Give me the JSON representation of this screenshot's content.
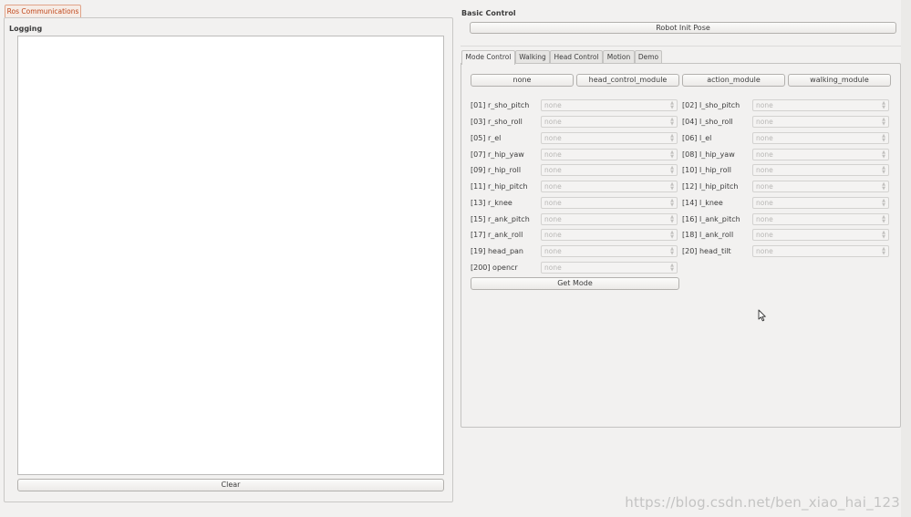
{
  "left_panel": {
    "tab_label": "Ros Communications",
    "logging_title": "Logging",
    "clear_label": "Clear"
  },
  "basic_control": {
    "title": "Basic Control",
    "robot_init_pose_label": "Robot Init Pose"
  },
  "tabs": [
    {
      "label": "Mode Control",
      "active": true
    },
    {
      "label": "Walking",
      "active": false
    },
    {
      "label": "Head Control",
      "active": false
    },
    {
      "label": "Motion",
      "active": false
    },
    {
      "label": "Demo",
      "active": false
    }
  ],
  "module_buttons": [
    "none",
    "head_control_module",
    "action_module",
    "walking_module"
  ],
  "joints": [
    {
      "label": "[01] r_sho_pitch",
      "value": "none"
    },
    {
      "label": "[02] l_sho_pitch",
      "value": "none"
    },
    {
      "label": "[03] r_sho_roll",
      "value": "none"
    },
    {
      "label": "[04] l_sho_roll",
      "value": "none"
    },
    {
      "label": "[05] r_el",
      "value": "none"
    },
    {
      "label": "[06] l_el",
      "value": "none"
    },
    {
      "label": "[07] r_hip_yaw",
      "value": "none"
    },
    {
      "label": "[08] l_hip_yaw",
      "value": "none"
    },
    {
      "label": "[09] r_hip_roll",
      "value": "none"
    },
    {
      "label": "[10] l_hip_roll",
      "value": "none"
    },
    {
      "label": "[11] r_hip_pitch",
      "value": "none"
    },
    {
      "label": "[12] l_hip_pitch",
      "value": "none"
    },
    {
      "label": "[13] r_knee",
      "value": "none"
    },
    {
      "label": "[14] l_knee",
      "value": "none"
    },
    {
      "label": "[15] r_ank_pitch",
      "value": "none"
    },
    {
      "label": "[16] l_ank_pitch",
      "value": "none"
    },
    {
      "label": "[17] r_ank_roll",
      "value": "none"
    },
    {
      "label": "[18] l_ank_roll",
      "value": "none"
    },
    {
      "label": "[19] head_pan",
      "value": "none"
    },
    {
      "label": "[20] head_tilt",
      "value": "none"
    },
    {
      "label": "[200] opencr",
      "value": "none"
    }
  ],
  "get_mode_label": "Get Mode",
  "watermark": "https://blog.csdn.net/ben_xiao_hai_123"
}
